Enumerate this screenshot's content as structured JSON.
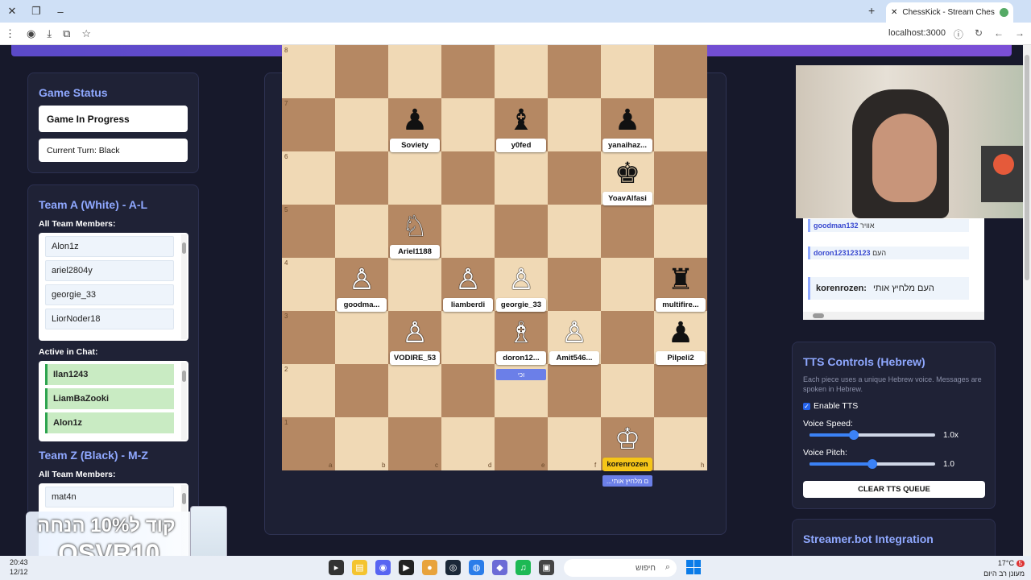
{
  "browser": {
    "tab_title": "ChessKick - Stream Chess G",
    "url": "localhost:3000"
  },
  "game_status": {
    "title": "Game Status",
    "state": "Game In Progress",
    "turn": "Current Turn: Black"
  },
  "team_a": {
    "title": "Team A (White) - A-L",
    "members_label": "All Team Members:",
    "members": [
      "Alon1z",
      "ariel2804y",
      "georgie_33",
      "LiorNoder18"
    ],
    "active_label": "Active in Chat:",
    "active": [
      "Ilan1243",
      "LiamBaZooki",
      "Alon1z"
    ]
  },
  "team_z": {
    "title": "Team Z (Black) - M-Z",
    "members_label": "All Team Members:",
    "members": [
      "mat4n"
    ]
  },
  "board": {
    "ranks": [
      "8",
      "7",
      "6",
      "5",
      "4",
      "3",
      "2",
      "1"
    ],
    "files": [
      "a",
      "b",
      "c",
      "d",
      "e",
      "f",
      "g",
      "h"
    ],
    "pieces": [
      {
        "square": "c7",
        "glyph": "♟",
        "color": "black",
        "name": "Soviety"
      },
      {
        "square": "e7",
        "glyph": "♝",
        "color": "black",
        "name": "y0fed"
      },
      {
        "square": "g7",
        "glyph": "♟",
        "color": "black",
        "name": "yanaihaz..."
      },
      {
        "square": "g6",
        "glyph": "♚",
        "color": "black",
        "name": "YoavAlfasi"
      },
      {
        "square": "c5",
        "glyph": "♘",
        "color": "white",
        "name": "Ariel1188"
      },
      {
        "square": "b4",
        "glyph": "♙",
        "color": "white",
        "name": "goodma..."
      },
      {
        "square": "d4",
        "glyph": "♙",
        "color": "white",
        "name": "liamberdi"
      },
      {
        "square": "e4",
        "glyph": "♙",
        "color": "white",
        "name": "georgie_33"
      },
      {
        "square": "h4",
        "glyph": "♜",
        "color": "black",
        "name": "multifire..."
      },
      {
        "square": "c3",
        "glyph": "♙",
        "color": "white",
        "name": "VODIRE_53"
      },
      {
        "square": "e3",
        "glyph": "♗",
        "color": "white",
        "name": "doron12..."
      },
      {
        "square": "f3",
        "glyph": "♙",
        "color": "white",
        "name": "Amit546..."
      },
      {
        "square": "h3",
        "glyph": "♟",
        "color": "black",
        "name": "Pilpeli2"
      },
      {
        "square": "g1",
        "glyph": "♔",
        "color": "white",
        "name": "korenrozen",
        "highlight": true
      }
    ],
    "bubbles": [
      {
        "square": "e3",
        "text": "וכי"
      },
      {
        "square": "g1",
        "text": "...ם מלחיץ אותי"
      }
    ]
  },
  "chat": {
    "lines": [
      {
        "user": "goodman132",
        "text": "אוויר"
      },
      {
        "user": "doron123123123",
        "text": "העם"
      }
    ],
    "last_user": "korenrozen:",
    "last_text": "העם מלחיץ אותי"
  },
  "tts": {
    "title": "TTS Controls (Hebrew)",
    "description": "Each piece uses a unique Hebrew voice. Messages are spoken in Hebrew.",
    "enable_label": "Enable TTS",
    "enabled": true,
    "speed_label": "Voice Speed:",
    "speed_value": "1.0x",
    "speed_fraction": 0.35,
    "pitch_label": "Voice Pitch:",
    "pitch_value": "1.0",
    "pitch_fraction": 0.5,
    "clear_label": "CLEAR TTS QUEUE"
  },
  "streamerbot": {
    "title": "Streamer.bot Integration"
  },
  "promo": {
    "line1": "קוד ל10% הנחה",
    "line2": "OSVR10"
  },
  "taskbar": {
    "time": "20:43",
    "date": "12/12",
    "search_placeholder": "חיפוש",
    "weather": "17°C",
    "weather_text": "מעונן רב היום",
    "notif_count": "5"
  }
}
